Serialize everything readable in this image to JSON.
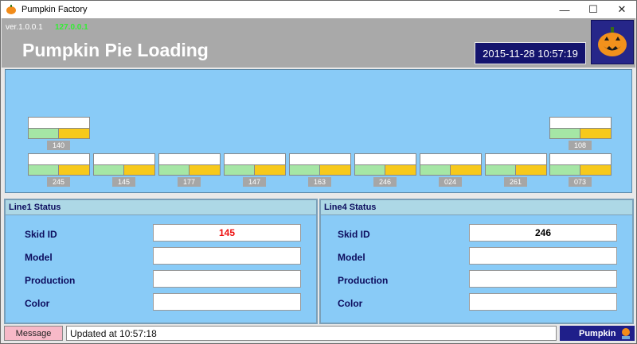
{
  "window": {
    "title": "Pumpkin Factory",
    "minimize_glyph": "—",
    "maximize_glyph": "☐",
    "close_glyph": "✕"
  },
  "header": {
    "version": "ver.1.0.0.1",
    "ip": "127.0.0.1",
    "title": "Pumpkin Pie Loading",
    "datetime": "2015-11-28 10:57:19"
  },
  "skids": {
    "top_left": "140",
    "top_right": "108",
    "row": [
      "245",
      "145",
      "177",
      "147",
      "163",
      "246",
      "024",
      "261",
      "073"
    ]
  },
  "line1": {
    "heading": "Line1 Status",
    "labels": {
      "skid_id": "Skid ID",
      "model": "Model",
      "production": "Production",
      "color": "Color"
    },
    "values": {
      "skid_id": "145",
      "model": "",
      "production": "",
      "color": ""
    },
    "skid_id_color": "#ee1111"
  },
  "line4": {
    "heading": "Line4 Status",
    "labels": {
      "skid_id": "Skid ID",
      "model": "Model",
      "production": "Production",
      "color": "Color"
    },
    "values": {
      "skid_id": "246",
      "model": "",
      "production": "",
      "color": ""
    },
    "skid_id_color": "#000000"
  },
  "statusbar": {
    "message_label": "Message",
    "message_text": "Updated at 10:57:18",
    "user": "Pumpkin"
  },
  "colors": {
    "loading_bg": "#89cbf7",
    "skid_green": "#a5e6a5",
    "skid_yellow": "#f7c91b",
    "datetime_bg": "#14146e"
  }
}
